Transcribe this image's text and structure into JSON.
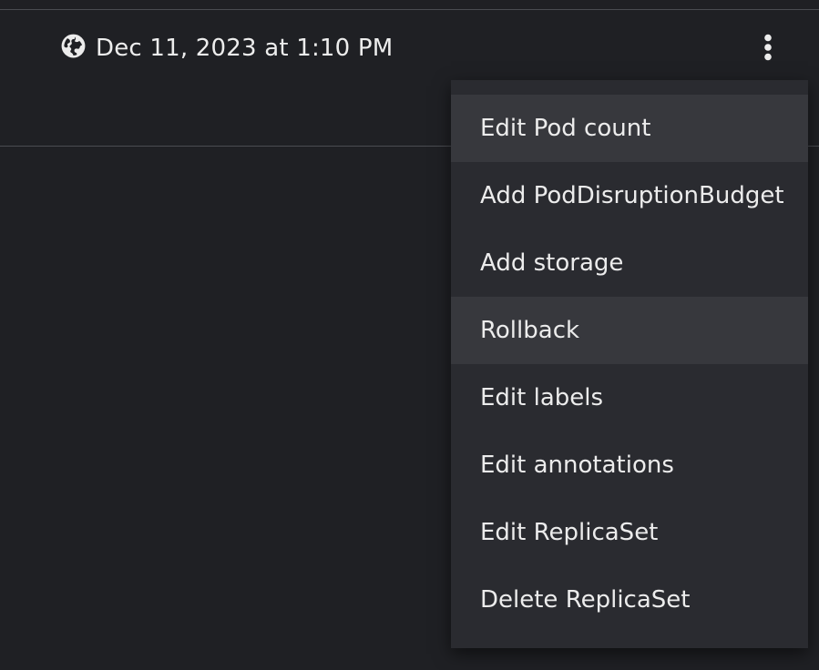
{
  "row": {
    "timestamp": "Dec 11, 2023 at 1:10 PM",
    "timestamp_icon": "globe-icon",
    "actions_icon": "kebab-vertical-icon"
  },
  "menu": {
    "items": [
      {
        "label": "Edit Pod count",
        "highlighted": true
      },
      {
        "label": "Add PodDisruptionBudget",
        "highlighted": false
      },
      {
        "label": "Add storage",
        "highlighted": false
      },
      {
        "label": "Rollback",
        "highlighted": true
      },
      {
        "label": "Edit labels",
        "highlighted": false
      },
      {
        "label": "Edit annotations",
        "highlighted": false
      },
      {
        "label": "Edit ReplicaSet",
        "highlighted": false
      },
      {
        "label": "Delete ReplicaSet",
        "highlighted": false
      }
    ]
  },
  "colors": {
    "background": "#1f2024",
    "menu_background": "#2a2b30",
    "menu_highlight": "#37383d",
    "divider": "#4a4c51",
    "text": "#ececec"
  }
}
